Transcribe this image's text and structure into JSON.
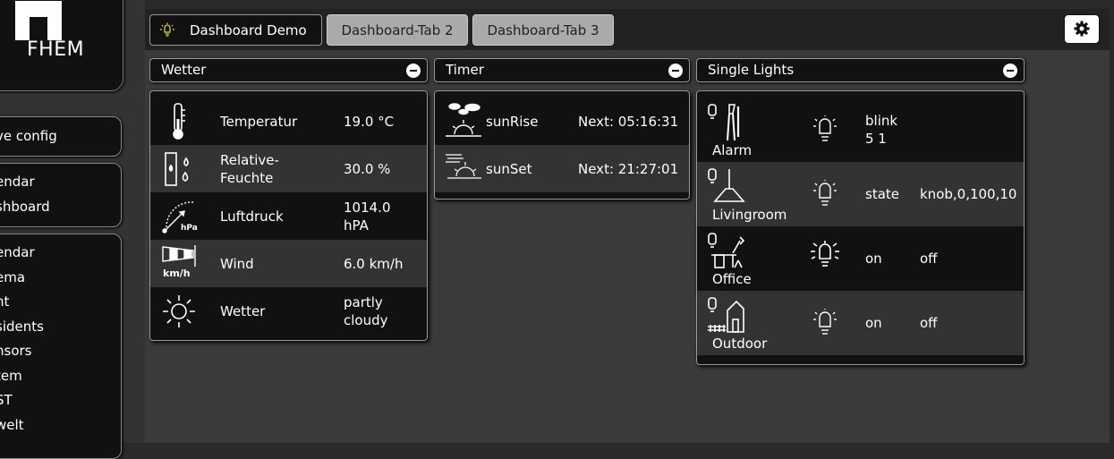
{
  "sidebar": {
    "logo_text": "FHEM",
    "box1": [
      "ve config"
    ],
    "box2": [
      "endar",
      "shboard"
    ],
    "box3": [
      "endar",
      "ema",
      "nt",
      "sidents",
      "nsors",
      "tem",
      "ST",
      "welt"
    ]
  },
  "tabs": {
    "tab1": "Dashboard Demo",
    "tab2": "Dashboard-Tab 2",
    "tab3": "Dashboard-Tab 3"
  },
  "wetter": {
    "title": "Wetter",
    "rows": [
      {
        "icon": "thermometer-icon",
        "label": "Temperatur",
        "value": "19.0 °C"
      },
      {
        "icon": "humidity-icon",
        "label": "Relative-Feuchte",
        "label1": "Relative-",
        "label2": "Feuchte",
        "value": "30.0 %"
      },
      {
        "icon": "barometer-icon",
        "icon_text": "hPa",
        "label": "Luftdruck",
        "value": "1014.0 hPA",
        "value1": "1014.0",
        "value2": "hPA"
      },
      {
        "icon": "windsock-icon",
        "icon_text": "km/h",
        "label": "Wind",
        "value": "6.0 km/h"
      },
      {
        "icon": "sun-icon",
        "label": "Wetter",
        "value": "partly cloudy",
        "value1": "partly",
        "value2": "cloudy"
      }
    ]
  },
  "timer": {
    "title": "Timer",
    "rows": [
      {
        "icon": "sunrise-icon",
        "label": "sunRise",
        "value": "Next: 05:16:31"
      },
      {
        "icon": "sunset-icon",
        "label": "sunSet",
        "value": "Next: 21:27:01"
      }
    ]
  },
  "lights": {
    "title": "Single Lights",
    "rows": [
      {
        "icon": "lamp-alarm-icon",
        "label": "Alarm",
        "state": "blink 5 1",
        "state1": "blink",
        "state2": "5 1",
        "extra": ""
      },
      {
        "icon": "ceiling-lamp-icon",
        "label": "Livingroom",
        "state": "state",
        "extra": "knob,0,100,10"
      },
      {
        "icon": "desk-lamp-icon",
        "label": "Office",
        "state": "on",
        "extra": "off"
      },
      {
        "icon": "outdoor-lamp-icon",
        "label": "Outdoor",
        "state": "on",
        "extra": "off"
      }
    ]
  },
  "colors": {
    "background": "#3a3a3a",
    "panel": "#111111",
    "row_alt": "#333333",
    "accent_icon": "#e0e040"
  }
}
